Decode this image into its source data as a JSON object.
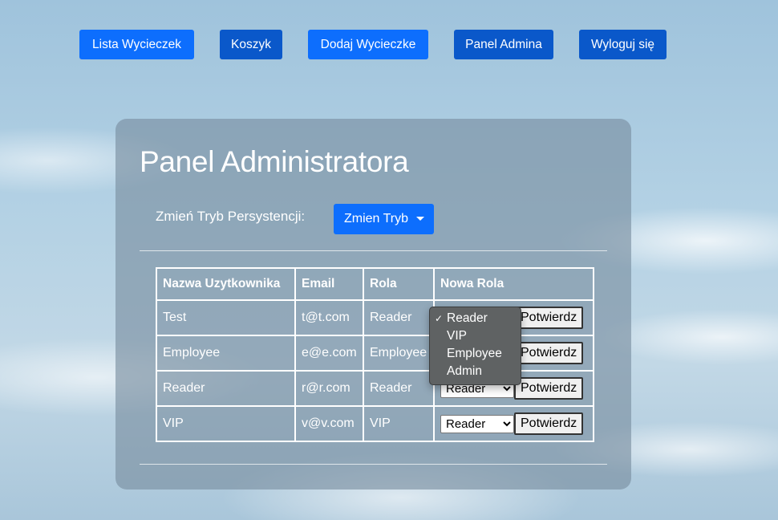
{
  "nav": {
    "items": [
      {
        "label": "Lista Wycieczek",
        "color": "#0d6efd"
      },
      {
        "label": "Koszyk",
        "color": "#0a58ca"
      },
      {
        "label": "Dodaj Wycieczke",
        "color": "#0d6efd"
      },
      {
        "label": "Panel Admina",
        "color": "#0a58ca"
      },
      {
        "label": "Wyloguj się",
        "color": "#0a58ca"
      }
    ]
  },
  "panel": {
    "title": "Panel Administratora",
    "mode_label": "Zmień Tryb Persystencji:",
    "mode_button": "Zmien Tryb"
  },
  "table": {
    "headers": [
      "Nazwa Uzytkownika",
      "Email",
      "Rola",
      "Nowa Rola"
    ],
    "confirm_label": "Potwierdz",
    "rows": [
      {
        "name": "Test",
        "email": "t@t.com",
        "role": "Reader",
        "new_role": "Reader"
      },
      {
        "name": "Employee",
        "email": "e@e.com",
        "role": "Employee",
        "new_role": "Reader"
      },
      {
        "name": "Reader",
        "email": "r@r.com",
        "role": "Reader",
        "new_role": "Reader"
      },
      {
        "name": "VIP",
        "email": "v@v.com",
        "role": "VIP",
        "new_role": "Reader"
      }
    ]
  },
  "dropdown": {
    "options": [
      "Reader",
      "VIP",
      "Employee",
      "Admin"
    ],
    "selected_mark": "✓"
  },
  "colors": {
    "primary": "#0d6efd",
    "primary_dark": "#0a58ca"
  }
}
